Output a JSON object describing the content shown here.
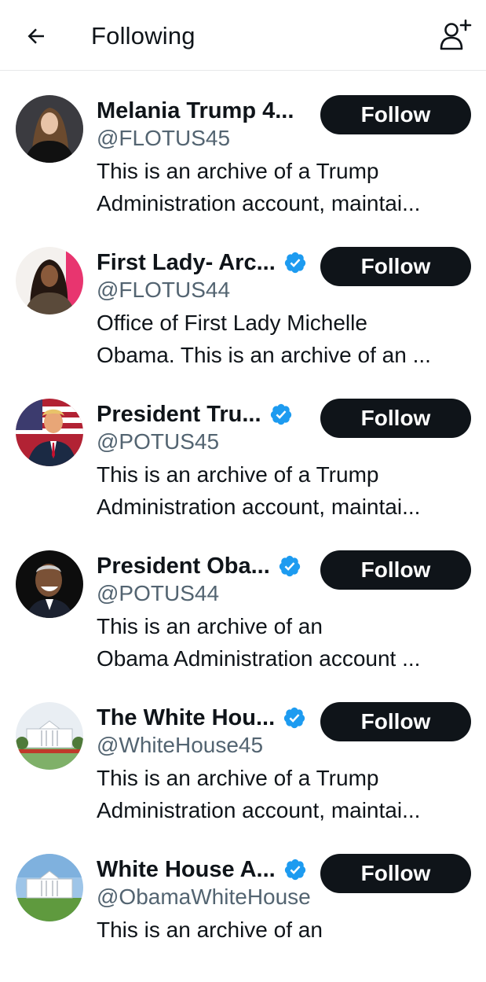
{
  "header": {
    "title": "Following"
  },
  "accounts": [
    {
      "name": "Melania Trump 4...",
      "handle": "@FLOTUS45",
      "verified": false,
      "bio": [
        "This is an archive of a Trump",
        "Administration account, maintai..."
      ],
      "button": "Follow"
    },
    {
      "name": "First Lady- Arc...",
      "handle": "@FLOTUS44",
      "verified": true,
      "bio": [
        "Office of First Lady Michelle",
        "Obama. This is an archive of an ..."
      ],
      "button": "Follow"
    },
    {
      "name": "President Tru...",
      "handle": "@POTUS45",
      "verified": true,
      "bio": [
        "This is an archive of a Trump",
        "Administration account, maintai..."
      ],
      "button": "Follow"
    },
    {
      "name": "President Oba...",
      "handle": "@POTUS44",
      "verified": true,
      "bio": [
        "This is an archive of an",
        "Obama Administration account ..."
      ],
      "button": "Follow"
    },
    {
      "name": "The White Hou...",
      "handle": "@WhiteHouse45",
      "verified": true,
      "bio": [
        "This is an archive of a Trump",
        "Administration account, maintai..."
      ],
      "button": "Follow"
    },
    {
      "name": "White House A...",
      "handle": "@ObamaWhiteHouse",
      "verified": true,
      "bio": [
        "This is an archive of an",
        ""
      ],
      "button": "Follow"
    }
  ],
  "colors": {
    "button_bg": "#0f1419",
    "verified": "#1d9bf0",
    "handle_text": "#536471"
  }
}
